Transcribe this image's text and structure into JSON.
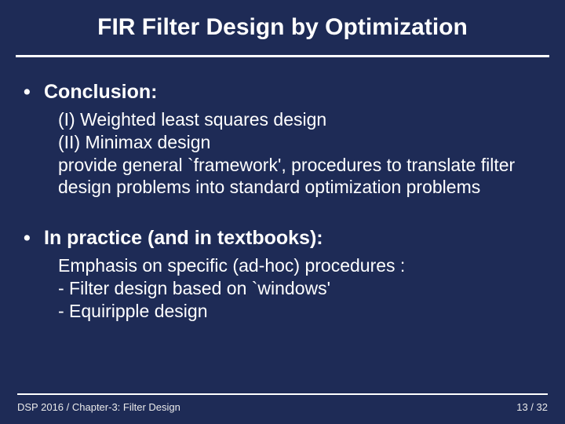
{
  "title": "FIR Filter Design by Optimization",
  "sections": [
    {
      "heading": "Conclusion:",
      "lines": [
        "(I) Weighted least squares design",
        "(II) Minimax design",
        "provide general `framework', procedures to translate filter design problems into standard optimization problems"
      ]
    },
    {
      "heading": "In practice (and in textbooks):",
      "lines": [
        "Emphasis on specific (ad-hoc) procedures :",
        "- Filter design based on `windows'",
        "- Equiripple design"
      ]
    }
  ],
  "footer": {
    "left": "DSP 2016  /  Chapter-3: Filter Design",
    "right": "13 / 32"
  }
}
